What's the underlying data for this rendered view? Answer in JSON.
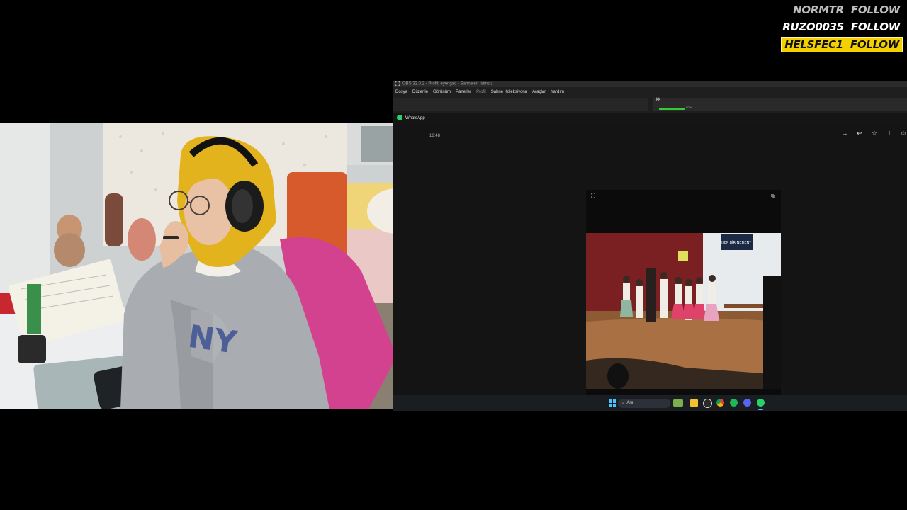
{
  "follows": [
    {
      "name": "NORMTR",
      "action": "FOLLOW",
      "style": "dim"
    },
    {
      "name": "RUZO0035",
      "action": "FOLLOW",
      "style": "white"
    },
    {
      "name": "HELSFEC1",
      "action": "FOLLOW",
      "style": "highlight"
    }
  ],
  "obs": {
    "title": "OBS 32.0.2 - Profil: eyengad - Sahneler: Isimsiz",
    "menu": [
      "Dosya",
      "Düzenle",
      "Görünüm",
      "Paneller",
      "Profil",
      "Sahne Koleksiyonu",
      "Araçlar",
      "Yardım"
    ],
    "panel_label": "kk",
    "level_label": "80%"
  },
  "whatsapp": {
    "app_name": "WhatsApp",
    "message_time": "18:48"
  },
  "video": {
    "progress": 0.88,
    "poster_text": "HEP BİR NEDEN?"
  },
  "taskbar": {
    "search_placeholder": "Ara"
  },
  "colors": {
    "highlight": "#f5d000",
    "hijab": "#e2b31c",
    "chair": "#d2428e",
    "whatsapp_green": "#25d366"
  }
}
